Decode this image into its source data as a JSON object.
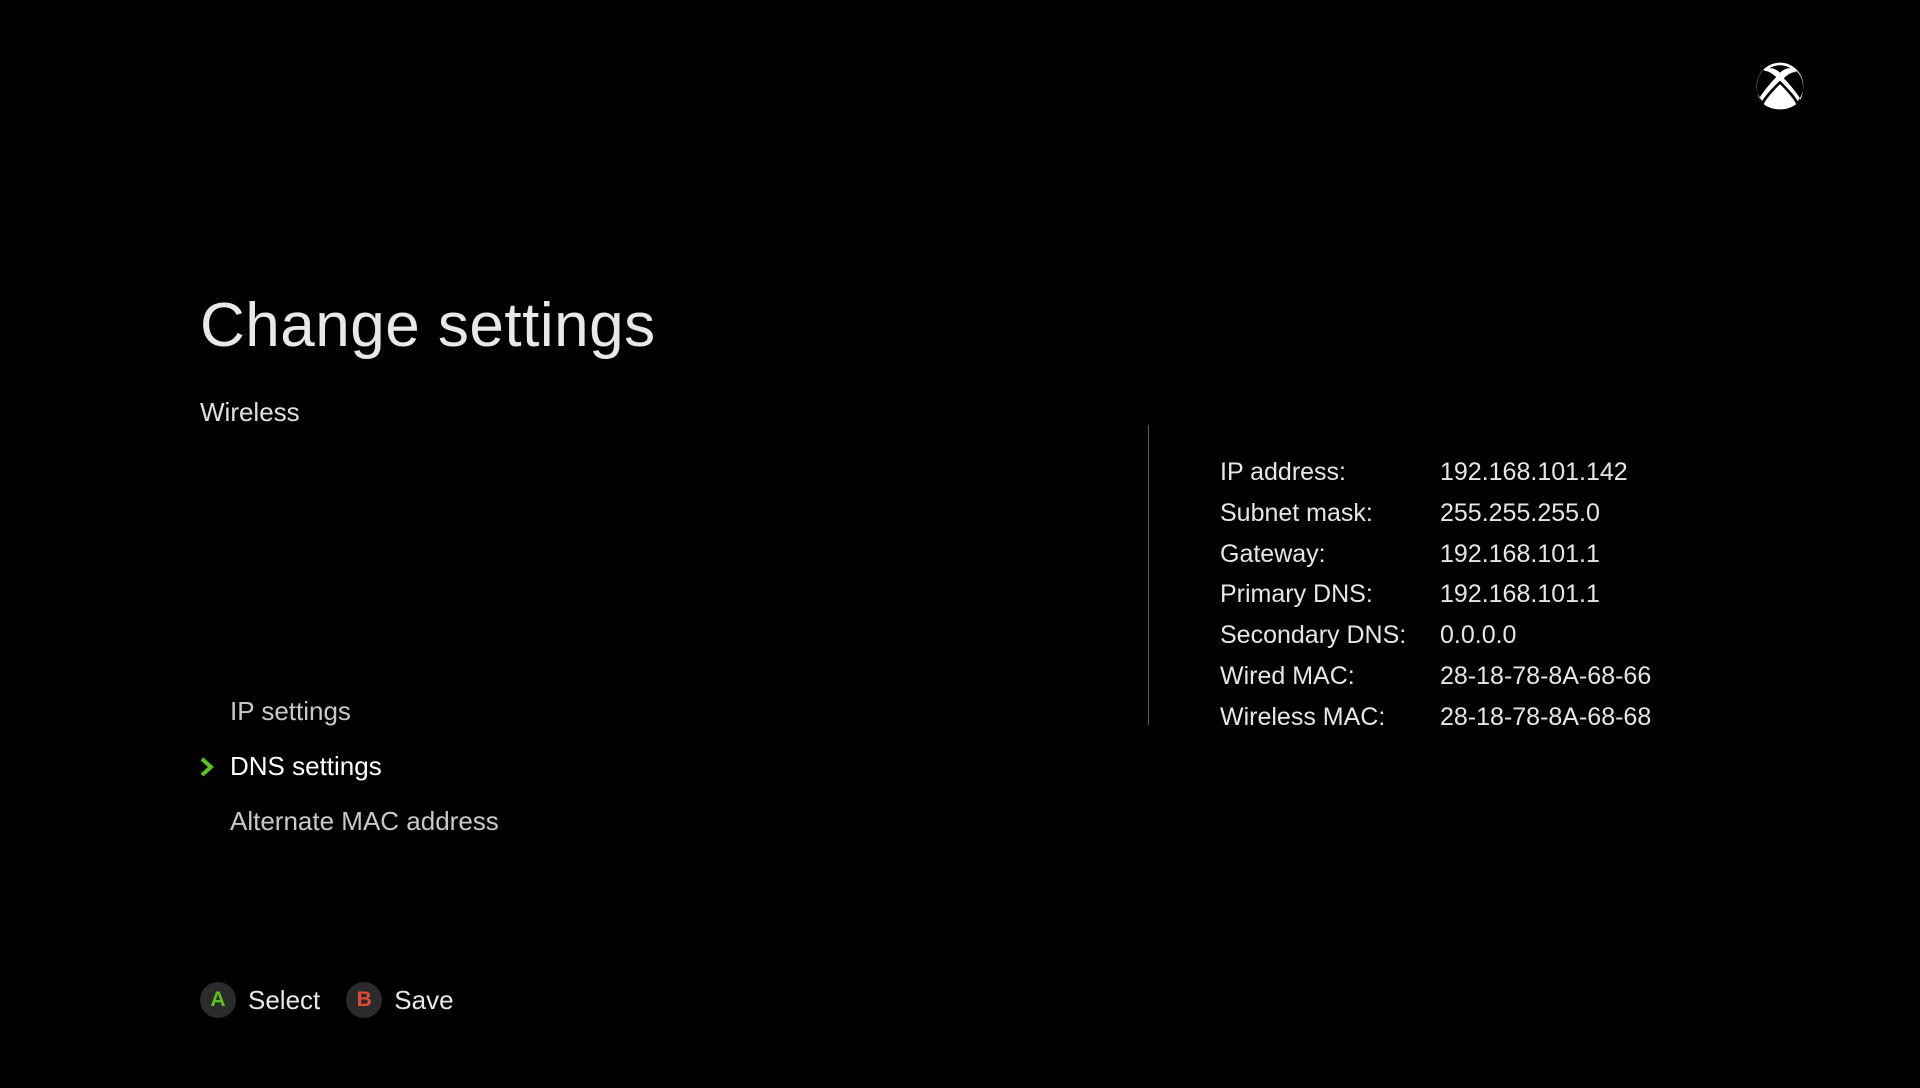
{
  "header": {
    "title": "Change settings",
    "subtitle": "Wireless"
  },
  "menu": {
    "items": [
      {
        "label": "IP settings",
        "selected": false
      },
      {
        "label": "DNS settings",
        "selected": true
      },
      {
        "label": "Alternate MAC address",
        "selected": false
      }
    ]
  },
  "info": {
    "rows": [
      {
        "label": "IP address:",
        "value": "192.168.101.142"
      },
      {
        "label": "Subnet mask:",
        "value": "255.255.255.0"
      },
      {
        "label": "Gateway:",
        "value": "192.168.101.1"
      },
      {
        "label": "Primary DNS:",
        "value": "192.168.101.1"
      },
      {
        "label": "Secondary DNS:",
        "value": "0.0.0.0"
      },
      {
        "label": "Wired MAC:",
        "value": "28-18-78-8A-68-66"
      },
      {
        "label": "Wireless MAC:",
        "value": "28-18-78-8A-68-68"
      }
    ]
  },
  "footer": {
    "hints": [
      {
        "key": "A",
        "color": "green",
        "label": "Select"
      },
      {
        "key": "B",
        "color": "red",
        "label": "Save"
      }
    ]
  }
}
